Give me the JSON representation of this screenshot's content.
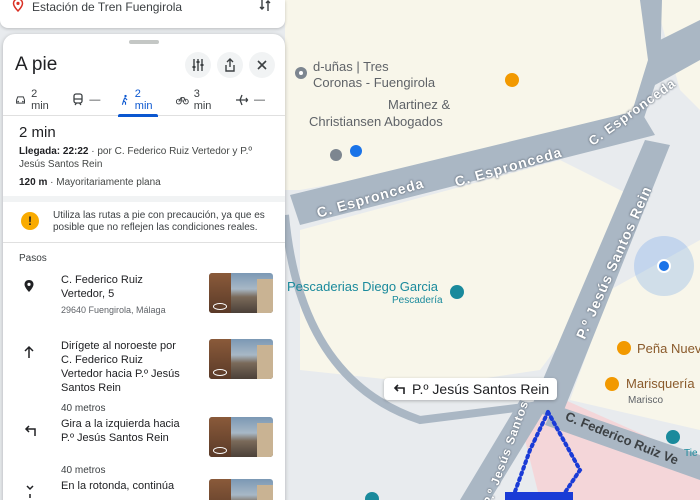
{
  "search": {
    "destination": "Estación de Tren Fuengirola"
  },
  "panel": {
    "title": "A pie",
    "modes": [
      {
        "icon": "car-icon",
        "label": "2 min"
      },
      {
        "icon": "train-icon",
        "label": "—"
      },
      {
        "icon": "walk-icon",
        "label": "2 min"
      },
      {
        "icon": "bike-icon",
        "label": "3 min"
      },
      {
        "icon": "plane-icon",
        "label": "—"
      }
    ],
    "summary": {
      "time": "2 min",
      "arrival_label": "Llegada: 22:22",
      "arrival_rest": " · por C. Federico Ruiz Vertedor y P.º Jesús Santos Rein",
      "distance": "120 m",
      "terrain": " · Mayoritariamente plana"
    },
    "warning": "Utiliza las rutas a pie con precaución, ya que es posible que no reflejen las condiciones reales.",
    "steps_title": "Pasos",
    "steps": [
      {
        "icon": "location-pin-icon",
        "text": "C. Federico Ruiz Vertedor, 5",
        "sub": "29640 Fuengirola, Málaga"
      },
      {
        "icon": "arrow-up-icon",
        "text": "Dirígete al noroeste por C. Federico Ruiz Vertedor hacia P.º Jesús Santos Rein",
        "distance": "40 metros"
      },
      {
        "icon": "turn-left-icon",
        "text": "Gira a la izquierda hacia P.º Jesús Santos Rein",
        "distance": "40 metros"
      },
      {
        "icon": "roundabout-icon",
        "text": "En la rotonda, continúa"
      }
    ]
  },
  "map": {
    "pois": {
      "unas_line1": "d-uñas | Tres",
      "unas_line2": "Coronas - Fuengirola",
      "lawyers_line1": "Martinez &",
      "lawyers_line2": "Christiansen Abogados",
      "pescaderias": "Pescaderias Diego Garcia",
      "pescaderia_sub": "Pescadería",
      "pena": "Peña Nueva",
      "marisqueria": "Marisquería",
      "marisco": "Marisco",
      "tie": "Tie"
    },
    "streets": {
      "espronceda1": "C. Espronceda",
      "espronceda2": "C. Espronceda",
      "espronceda3": "C. Espronceda",
      "santos_rein1": "P.º Jesús Santos Rein",
      "santos_rein2": "P.º Jesús Santos",
      "federico": "C. Federico Ruiz Ve"
    },
    "route_label": "P.º Jesús Santos Rein",
    "colors": {
      "road": "#aab7c4",
      "block": "#f8f6ea",
      "route": "#1a3bd6",
      "location": "#1a73e8"
    }
  }
}
